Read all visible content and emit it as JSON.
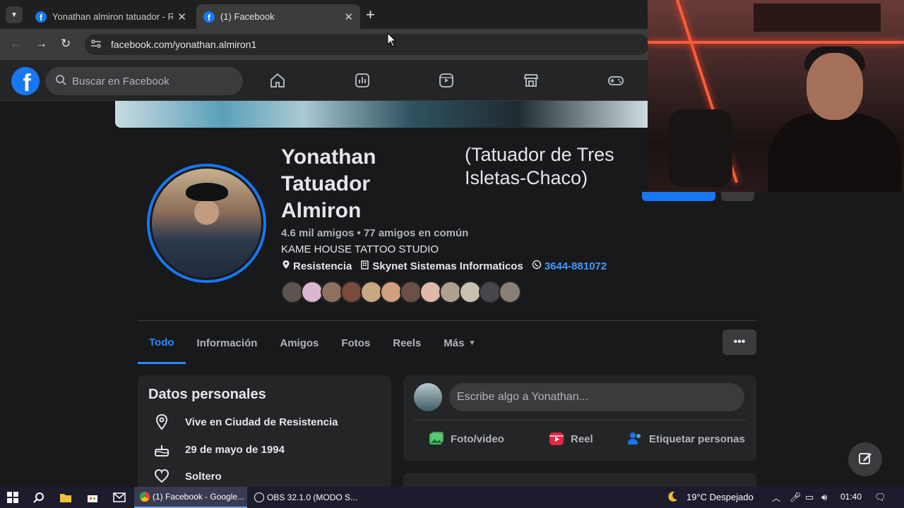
{
  "browser": {
    "tabs": [
      {
        "title": "Yonathan almiron tatuador - Re",
        "active": false
      },
      {
        "title": "(1) Facebook",
        "active": true
      }
    ],
    "url": "facebook.com/yonathan.almiron1"
  },
  "facebook": {
    "search_placeholder": "Buscar en Facebook",
    "nav_icons": [
      "home-icon",
      "stats-icon",
      "reels-icon",
      "marketplace-icon",
      "gaming-icon"
    ],
    "profile": {
      "name": "Yonathan Tatuador Almiron",
      "name_lines": [
        "Yonathan",
        "Tatuador",
        "Almiron"
      ],
      "alt_name_lines": [
        "(Tatuador de Tres",
        "Isletas-Chaco)"
      ],
      "friends": "4.6 mil amigos • 77 amigos en común",
      "work": "KAME HOUSE TATTOO STUDIO",
      "location": "Resistencia",
      "company": "Skynet Sistemas Informaticos",
      "phone": "3644-881072"
    },
    "profile_tabs": [
      "Todo",
      "Información",
      "Amigos",
      "Fotos",
      "Reels",
      "Más"
    ],
    "active_tab": "Todo",
    "personal": {
      "title": "Datos personales",
      "items": [
        "Vive en Ciudad de Resistencia",
        "29 de mayo de 1994",
        "Soltero"
      ]
    },
    "composer": {
      "placeholder": "Escribe algo a Yonathan...",
      "actions": [
        "Foto/video",
        "Reel",
        "Etiquetar personas"
      ]
    }
  },
  "taskbar": {
    "apps": [
      "(1) Facebook - Google...",
      "OBS 32.1.0 (MODO S..."
    ],
    "weather": "19°C  Despejado",
    "time": "01:40"
  },
  "colors": {
    "accent": "#1877f2",
    "link": "#2d88ff",
    "bg": "#18191a",
    "card": "#242526"
  }
}
